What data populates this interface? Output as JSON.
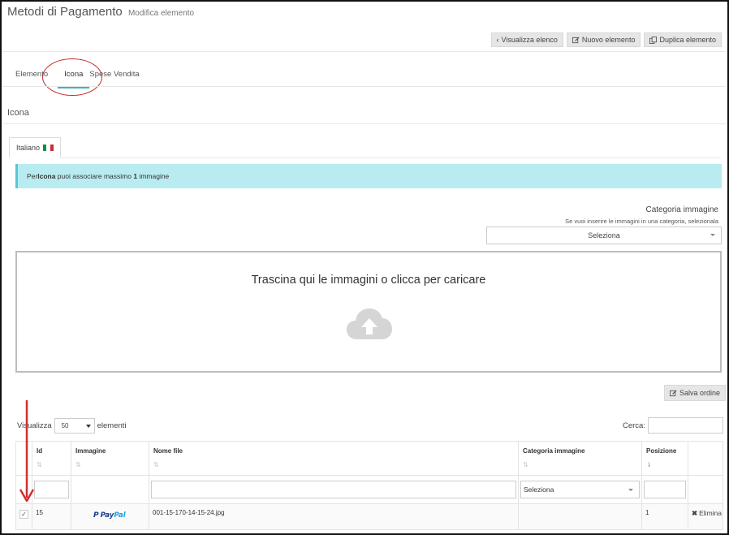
{
  "header": {
    "title": "Metodi di Pagamento",
    "subtitle": "Modifica elemento"
  },
  "toolbar": {
    "view_list": {
      "icon": "chevron-left-icon",
      "label": "Visualizza elenco"
    },
    "new_item": {
      "icon": "edit-icon",
      "label": "Nuovo elemento"
    },
    "duplicate": {
      "icon": "copy-icon",
      "label": "Duplica elemento"
    }
  },
  "tabs": [
    {
      "label": "Elemento",
      "active": false
    },
    {
      "label": "Icona",
      "active": true
    },
    {
      "label": "Spese Vendita",
      "active": false
    }
  ],
  "section_title": "Icona",
  "language_tab": {
    "label": "Italiano",
    "flag_colors": [
      "#009246",
      "#ffffff",
      "#ce2b37"
    ]
  },
  "info": {
    "prefix": "Per ",
    "field": "Icona",
    "middle": " puoi associare massimo ",
    "count": "1",
    "suffix": " immagine"
  },
  "category": {
    "title": "Categoria immagine",
    "hint": "Se vuoi inserire le immagini in una categoria, selezionala",
    "selected": "Seleziona"
  },
  "dropzone": {
    "text": "Trascina qui le immagini o clicca per caricare",
    "icon": "cloud-upload-icon"
  },
  "save_order": {
    "icon": "edit-icon",
    "label": "Salva ordine"
  },
  "table_controls": {
    "show_label": "Visualizza",
    "page_size": "50",
    "elements_label": "elementi",
    "search_label": "Cerca:"
  },
  "table": {
    "columns": [
      {
        "key": "select",
        "label": ""
      },
      {
        "key": "id",
        "label": "Id"
      },
      {
        "key": "image",
        "label": "Immagine"
      },
      {
        "key": "filename",
        "label": "Nome file"
      },
      {
        "key": "category",
        "label": "Categoria immagine"
      },
      {
        "key": "position",
        "label": "Posizione"
      },
      {
        "key": "actions",
        "label": ""
      }
    ],
    "filter_category": "Seleziona",
    "rows": [
      {
        "checked": true,
        "id": "15",
        "image_brand": "PayPal",
        "image_brand_parts": [
          "Pay",
          "Pal"
        ],
        "filename": "001-15-170-14-15-24.jpg",
        "category": "",
        "position": "1",
        "delete_label": "Elimina"
      }
    ]
  },
  "colors": {
    "accent": "#38b4c4",
    "info_bg": "#b9ecf1",
    "annotation": "#c62828",
    "arrow": "#d32f2f"
  }
}
